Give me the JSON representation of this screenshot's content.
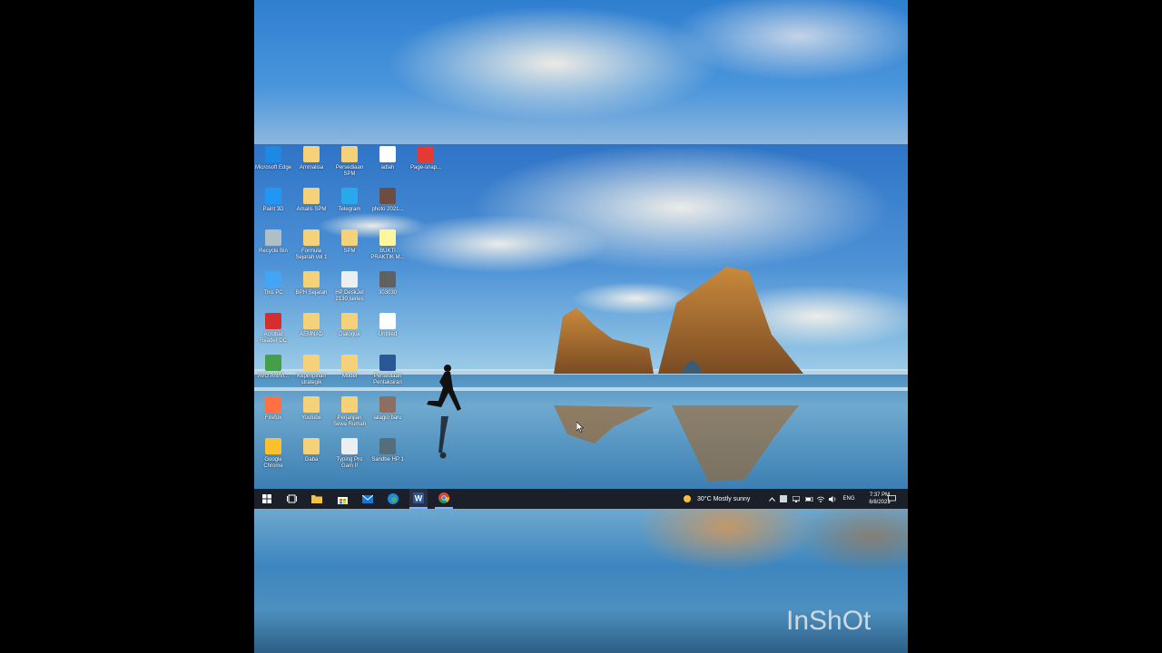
{
  "desktop_icons": [
    {
      "label": "Microsoft Edge",
      "color": "#1e88e5"
    },
    {
      "label": "Ammalisa",
      "color": "#f5d27a"
    },
    {
      "label": "Persediaan SPM",
      "color": "#f5d27a"
    },
    {
      "label": "adlah",
      "color": "#ffffff"
    },
    {
      "label": "Page-snap...",
      "color": "#e53935"
    },
    {
      "label": "Paint 3D",
      "color": "#2196f3"
    },
    {
      "label": "Amalis SPM",
      "color": "#f5d27a"
    },
    {
      "label": "Telegram",
      "color": "#29a9eb"
    },
    {
      "label": "photo 2021...",
      "color": "#6d4c41"
    },
    {
      "label": "Recycle Bin",
      "color": "#b0bec5"
    },
    {
      "label": "Formula Sejarah vol 1",
      "color": "#f5d27a"
    },
    {
      "label": "SPM",
      "color": "#f5d27a"
    },
    {
      "label": "BUKTI PRAKTIK M...",
      "color": "#fff59d"
    },
    {
      "label": "This PC",
      "color": "#42a5f5"
    },
    {
      "label": "BPH Sejarah",
      "color": "#f5d27a"
    },
    {
      "label": "HP DeskJet 2130 series",
      "color": "#eceff1"
    },
    {
      "label": "303030",
      "color": "#616161"
    },
    {
      "label": "Acrobat Reader DC",
      "color": "#d32f2f"
    },
    {
      "label": "AEMNAD",
      "color": "#f5d27a"
    },
    {
      "label": "Dialogue",
      "color": "#f5d27a"
    },
    {
      "label": "Untitled",
      "color": "#ffffff"
    },
    {
      "label": "AVG AntiVi...",
      "color": "#43a047"
    },
    {
      "label": "Kepimpinan strategik",
      "color": "#f5d27a"
    },
    {
      "label": "Model",
      "color": "#f5d27a"
    },
    {
      "label": "Persediaan Pentaksiran",
      "color": "#2b5797"
    },
    {
      "label": "Firefox",
      "color": "#ff7043"
    },
    {
      "label": "Youtube",
      "color": "#f5d27a"
    },
    {
      "label": "Perjanjian Sewa Rumah",
      "color": "#f5d27a"
    },
    {
      "label": "ialagio baru",
      "color": "#8d6e63"
    },
    {
      "label": "Google Chrome",
      "color": "#fbc02d"
    },
    {
      "label": "Gaba",
      "color": "#f5d27a"
    },
    {
      "label": "Typing Pro Gam II",
      "color": "#eceff1"
    },
    {
      "label": "Sandbe HP 1",
      "color": "#546e7a"
    }
  ],
  "taskbar": {
    "weather": "30°C  Mostly sunny",
    "language": "ENG",
    "time": "7:37 PM",
    "date": "6/8/2021"
  },
  "watermark": "InShOt",
  "colors": {
    "taskbar_bg": "#1b1f2a",
    "start_accent": "#ffffff",
    "word_blue": "#2b5797",
    "edge_blue": "#1e88e5"
  }
}
